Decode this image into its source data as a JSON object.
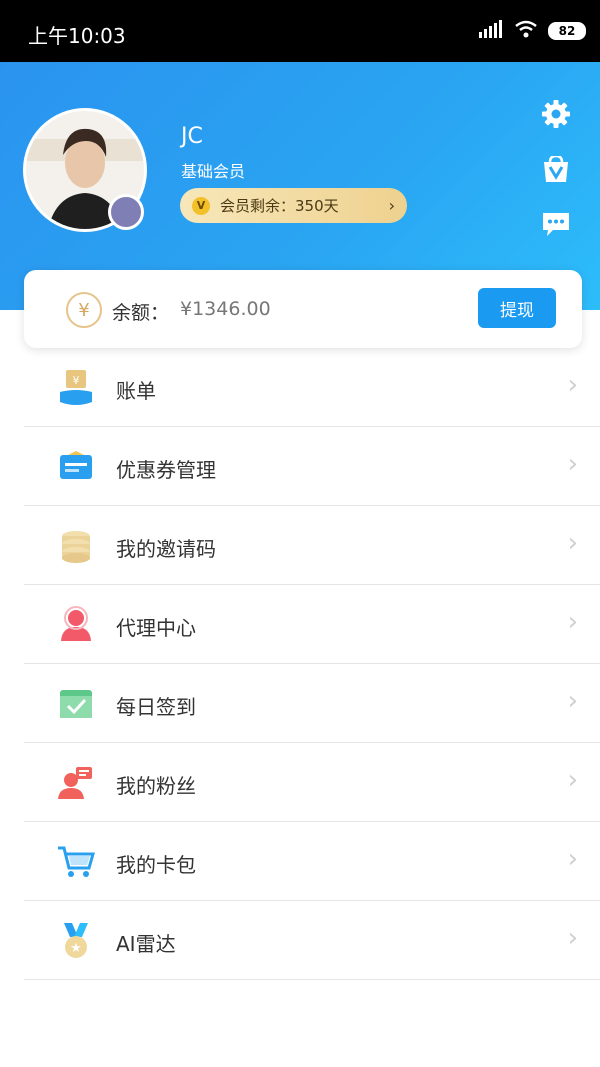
{
  "status_bar": {
    "time": "上午10:03",
    "battery": "82"
  },
  "profile": {
    "name": "JC",
    "level": "基础会员",
    "membership_remaining": "会员剩余：350天"
  },
  "header_icons": [
    "gear-icon",
    "vip-shop-icon",
    "message-icon"
  ],
  "balance": {
    "label": "余额：",
    "value": "¥1346.00",
    "withdraw_label": "提现"
  },
  "menu": {
    "items": [
      {
        "label": "账单"
      },
      {
        "label": "优惠券管理"
      },
      {
        "label": "我的邀请码"
      },
      {
        "label": "代理中心"
      },
      {
        "label": "每日签到"
      },
      {
        "label": "我的粉丝"
      },
      {
        "label": "我的卡包"
      },
      {
        "label": "AI雷达"
      }
    ]
  },
  "colors": {
    "brand_blue": "#2aa6f2",
    "button_blue": "#1a9bf1",
    "gold": "#eed18f"
  }
}
